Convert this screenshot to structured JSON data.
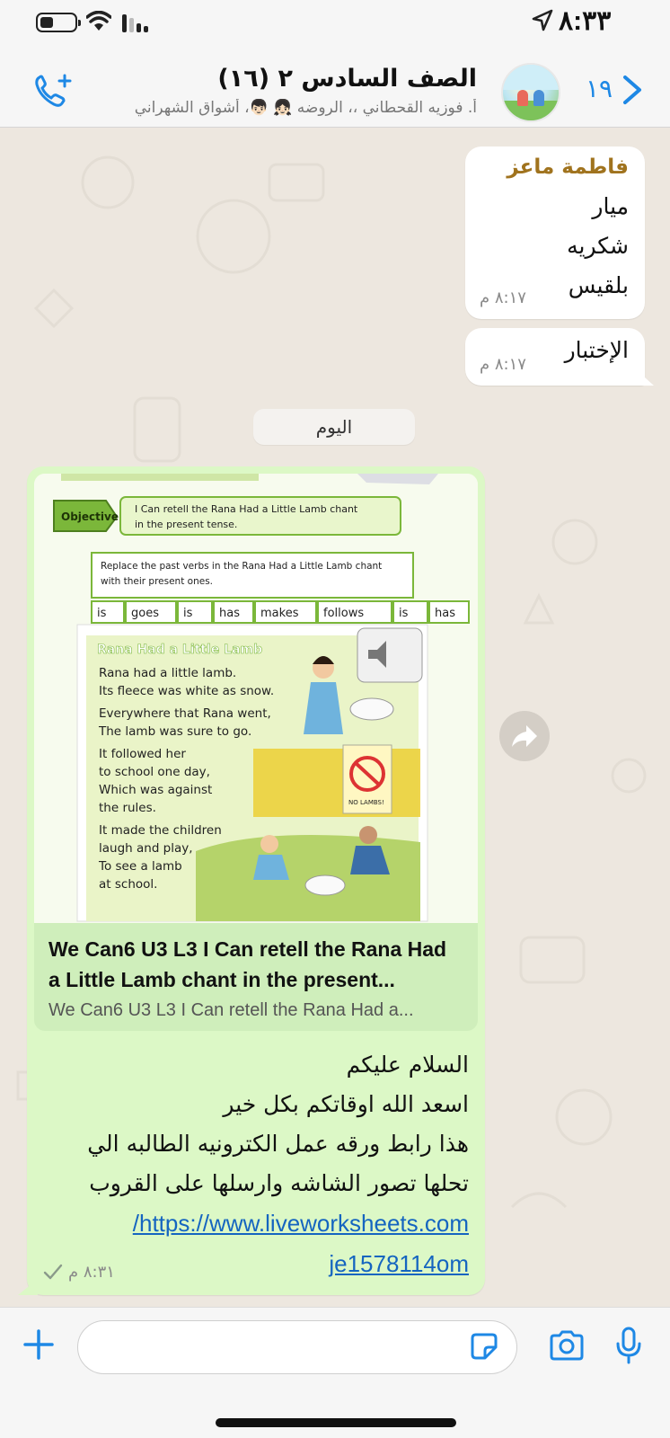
{
  "status_bar": {
    "time": "٨:٣٣",
    "icons": [
      "battery-icon",
      "wifi-icon",
      "signal-icon",
      "location-arrow-icon"
    ]
  },
  "header": {
    "title": "الصف السادس ٢ (١٦)",
    "subtitle": "أ. فوزيه القحطاني ،، الروضه 👧🏻 👦🏻، أشواق الشهراني",
    "unread_count": "١٩",
    "icons": [
      "back-chevron-icon",
      "add-call-icon"
    ],
    "accent_color": "#1e88e5"
  },
  "messages": [
    {
      "sender": "فاطمة ماعز",
      "lines": [
        "ميار",
        "شكريه",
        "بلقيس"
      ],
      "time": "٨:١٧ م"
    },
    {
      "lines": [
        "الإختبار"
      ],
      "time": "٨:١٧ م"
    }
  ],
  "day_separator": "اليوم",
  "outgoing": {
    "preview_image": {
      "objective_label": "Objective:",
      "objective_text": [
        "I Can retell the Rana Had a Little Lamb chant",
        "in the present tense."
      ],
      "instruction": [
        "Replace the past verbs in the Rana Had a Little Lamb chant",
        "with their present ones."
      ],
      "word_bank": [
        "is",
        "goes",
        "is",
        "has",
        "makes",
        "follows",
        "is",
        "has"
      ],
      "poem_title": "Rana Had a Little Lamb",
      "poem_lines": [
        "Rana had a little lamb.",
        "Its fleece was white as snow.",
        "Everywhere that Rana went,",
        "The lamb was sure to go.",
        "It followed her",
        "to school one day,",
        "Which was against",
        "the rules.",
        "It made the children",
        "laugh and play,",
        "To see a lamb",
        "at school."
      ],
      "sign_text": "NO LAMBS!"
    },
    "link_title": "We Can6 U3 L3 I Can retell  the Rana Had a Little Lamb chant in the present...",
    "link_desc": "We Can6 U3 L3 I Can retell  the Rana Had a...",
    "text_lines": [
      "السلام عليكم",
      "اسعد الله اوقاتكم بكل خير",
      "هذا رابط ورقه عمل الكترونيه الطالبه الي",
      "تحلها تصور الشاشه وارسلها على القروب"
    ],
    "url_line1": "https://www.liveworksheets.com/",
    "url_line2": "je1578114om",
    "time": "٨:٣١ م",
    "bubble_color": "#dcf8c6"
  },
  "input_bar": {
    "placeholder": "",
    "icons": [
      "plus-icon",
      "sticker-icon",
      "camera-icon",
      "microphone-icon"
    ]
  }
}
